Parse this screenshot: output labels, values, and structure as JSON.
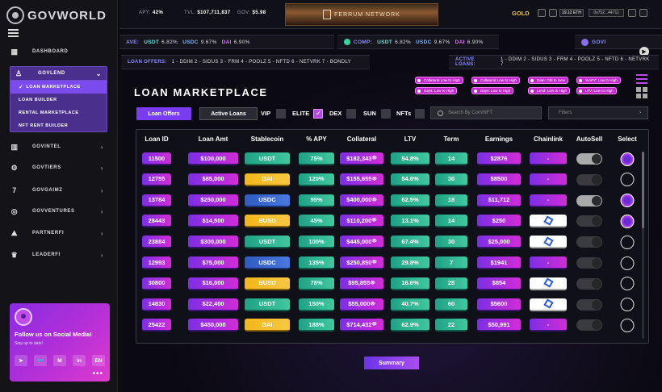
{
  "app": {
    "brand": "GOVWORLD"
  },
  "topbar": {
    "apy_label": "APY:",
    "apy_value": "42%",
    "tvl_label": "TVL:",
    "tvl_value": "$107,711,837",
    "gov_label": "GOV:",
    "gov_value": "$5.98",
    "banner": "FERRUM NETWORK",
    "gold": "GOLD",
    "eth": "19.12 ETH",
    "address": "0x752...44711"
  },
  "ticker1": {
    "label": "AVE:",
    "items": [
      {
        "n": "USDT",
        "v": "6.82%"
      },
      {
        "n": "USDC",
        "v": "9.67%"
      },
      {
        "n": "DAI",
        "v": "6.90%"
      }
    ]
  },
  "ticker2": {
    "label": "COMP:",
    "items": [
      {
        "n": "USDT",
        "v": "6.82%"
      },
      {
        "n": "USDC",
        "v": "9.67%"
      },
      {
        "n": "DAI",
        "v": "6.90%"
      }
    ]
  },
  "ticker2b": {
    "label": "GOVI"
  },
  "ticker3": {
    "label": "LOAN OFFERS:",
    "text": "1 - DDIM  2 - SIDUS  3 - FRM  4 - POOLZ  5 - NFTD  6 - NETVRK  7 - BONDLY"
  },
  "ticker4": {
    "label": "ACTIVE LOANS:",
    "text": "1 - DDIM  2 - SIDUS  3 - FRM  4 - POOLZ  5 - NFTD  6 - NETVRK  7"
  },
  "sidebar": {
    "dashboard": "DASHBOARD",
    "govlend": "GOVLEND",
    "sub": [
      "LOAN MARKETPLACE",
      "LOAN BUILDER",
      "RENTAL MARKETPLACE",
      "NFT RENT BUILDER"
    ],
    "items": [
      "GOVINTEL",
      "GOVTIERS",
      "GOVGAIMZ",
      "GOVVENTURES",
      "PARTNERFI",
      "LEADERFI"
    ]
  },
  "social": {
    "title": "Follow us on Social Media!",
    "subtitle": "Stay up to date!",
    "icons": [
      "telegram",
      "twitter",
      "medium",
      "linkedin",
      "EN"
    ],
    "lang": "EN"
  },
  "chips": [
    "Collateral Low to High",
    "Collateral Low to High",
    "Date: Old to New",
    "%APY: Low to High",
    "Days: Low to High",
    "Days: Low to High",
    "Lend: Low to High",
    "LTV: Low to High"
  ],
  "page": {
    "title": "LOAN MARKETPLACE"
  },
  "tabs": {
    "offers": "Loan Offers",
    "active": "Active Loans"
  },
  "filters": {
    "vip": "VIP",
    "elite": "ELITE",
    "dex": "DEX",
    "sun": "SUN",
    "nfts": "NFTs",
    "elite_checked": true,
    "search_placeholder": "Search By Coin/NFT",
    "filters_label": "Filters"
  },
  "table": {
    "headers": [
      "Loan ID",
      "Loan Amt",
      "Stablecoin",
      "% APY",
      "Collateral",
      "LTV",
      "Term",
      "Earnings",
      "Chainlink",
      "AutoSell",
      "Select"
    ],
    "rows": [
      {
        "id": "11500",
        "amt": "$100,000",
        "coin": "USDT",
        "apy": "75%",
        "col": "$182,343",
        "ltv": "54.8%",
        "term": "14",
        "earn": "$2876",
        "chain": "-",
        "auto": true,
        "sel": true
      },
      {
        "id": "12755",
        "amt": "$85,000",
        "coin": "DAI",
        "apy": "120%",
        "col": "$155,655",
        "ltv": "54.6%",
        "term": "30",
        "earn": "$8500",
        "chain": "-",
        "auto": false,
        "sel": false
      },
      {
        "id": "13784",
        "amt": "$250,000",
        "coin": "USDC",
        "apy": "95%",
        "col": "$400,000",
        "ltv": "62.5%",
        "term": "18",
        "earn": "$11,712",
        "chain": "-",
        "auto": true,
        "sel": true
      },
      {
        "id": "28443",
        "amt": "$14,500",
        "coin": "BUSD",
        "apy": "45%",
        "col": "$110,200",
        "ltv": "13.1%",
        "term": "14",
        "earn": "$250",
        "chain": "link",
        "auto": false,
        "sel": true
      },
      {
        "id": "23884",
        "amt": "$300,000",
        "coin": "USDT",
        "apy": "100%",
        "col": "$445,000",
        "ltv": "67.4%",
        "term": "30",
        "earn": "$25,000",
        "chain": "link",
        "auto": false,
        "sel": false
      },
      {
        "id": "12993",
        "amt": "$75,000",
        "coin": "USDC",
        "apy": "135%",
        "col": "$250,850",
        "ltv": "29.8%",
        "term": "7",
        "earn": "$1941",
        "chain": "-",
        "auto": false,
        "sel": false
      },
      {
        "id": "30800",
        "amt": "$16,000",
        "coin": "BUSD",
        "apy": "78%",
        "col": "$95,855",
        "ltv": "16.6%",
        "term": "25",
        "earn": "$854",
        "chain": "link",
        "auto": false,
        "sel": false
      },
      {
        "id": "14830",
        "amt": "$22,400",
        "coin": "USDT",
        "apy": "150%",
        "col": "$55,000",
        "ltv": "40.7%",
        "term": "60",
        "earn": "$5600",
        "chain": "link",
        "auto": false,
        "sel": false
      },
      {
        "id": "25422",
        "amt": "$450,000",
        "coin": "DAI",
        "apy": "188%",
        "col": "$714,432",
        "ltv": "62.9%",
        "term": "22",
        "earn": "$50,991",
        "chain": "-",
        "auto": false,
        "sel": false
      }
    ]
  },
  "summary": "Summary",
  "colors": {
    "accent": "#7a3cf0",
    "pink": "#d22cd6",
    "teal": "#1fa285",
    "gold": "#e8c24a"
  }
}
